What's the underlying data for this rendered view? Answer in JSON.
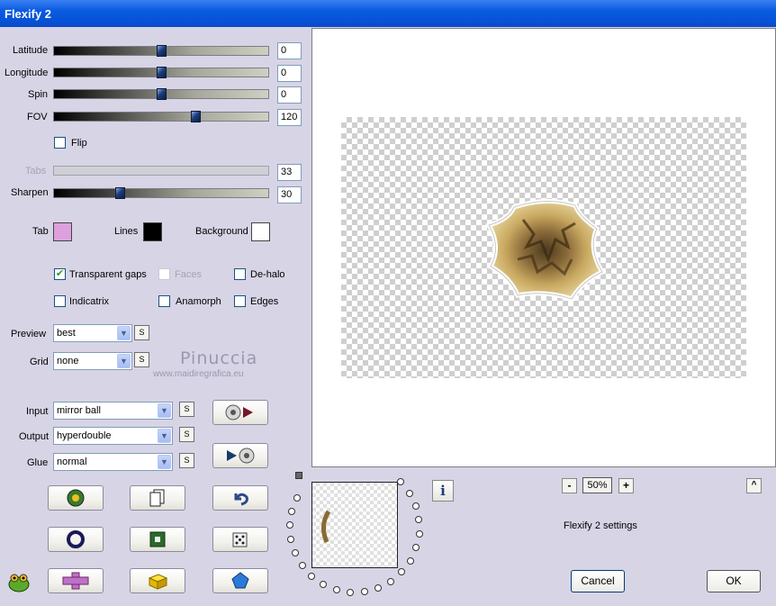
{
  "window": {
    "title": "Flexify 2"
  },
  "sliders": [
    {
      "id": "latitude",
      "label": "Latitude",
      "value": "0",
      "level": 0.5,
      "enabled": true
    },
    {
      "id": "longitude",
      "label": "Longitude",
      "value": "0",
      "level": 0.5,
      "enabled": true
    },
    {
      "id": "spin",
      "label": "Spin",
      "value": "0",
      "level": 0.5,
      "enabled": true
    },
    {
      "id": "fov",
      "label": "FOV",
      "value": "120",
      "level": 0.66,
      "enabled": true
    },
    {
      "id": "tabs",
      "label": "Tabs",
      "value": "33",
      "level": 0.33,
      "enabled": false
    },
    {
      "id": "sharpen",
      "label": "Sharpen",
      "value": "30",
      "level": 0.3,
      "enabled": true
    }
  ],
  "flip": {
    "label": "Flip",
    "checked": false
  },
  "colors": {
    "tab": {
      "label": "Tab",
      "color": "#dda0dd"
    },
    "lines": {
      "label": "Lines",
      "color": "#000000"
    },
    "background": {
      "label": "Background",
      "color": "#ffffff"
    }
  },
  "options": {
    "transparent_gaps": {
      "label": "Transparent gaps",
      "checked": true
    },
    "faces": {
      "label": "Faces",
      "checked": false,
      "enabled": false
    },
    "de_halo": {
      "label": "De-halo",
      "checked": false
    },
    "indicatrix": {
      "label": "Indicatrix",
      "checked": false
    },
    "anamorph": {
      "label": "Anamorph",
      "checked": false
    },
    "edges": {
      "label": "Edges",
      "checked": false
    }
  },
  "selects": {
    "preview": {
      "label": "Preview",
      "value": "best"
    },
    "grid": {
      "label": "Grid",
      "value": "none"
    },
    "input": {
      "label": "Input",
      "value": "mirror ball"
    },
    "output": {
      "label": "Output",
      "value": "hyperdouble"
    },
    "glue": {
      "label": "Glue",
      "value": "normal"
    }
  },
  "s_button_label": "S",
  "watermark": {
    "name": "Pinuccia",
    "url": "www.maidiregrafica.eu"
  },
  "zoom": {
    "minus": "-",
    "value": "50%",
    "plus": "+"
  },
  "info_label": "i",
  "up_label": "^",
  "status_text": "Flexify 2 settings",
  "buttons": {
    "cancel": "Cancel",
    "ok": "OK"
  },
  "accent_color": "#0a5ae0"
}
